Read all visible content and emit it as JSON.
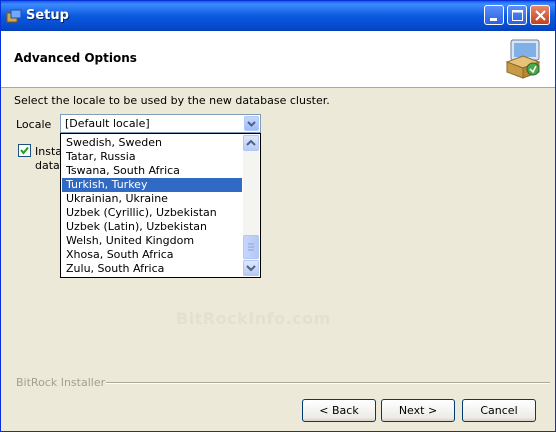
{
  "window": {
    "title": "Setup",
    "minimize_icon": "minimize-icon",
    "maximize_icon": "maximize-icon",
    "close_icon": "close-icon"
  },
  "header": {
    "title": "Advanced Options",
    "icon": "installer-box-icon"
  },
  "instruction": "Select the locale to be used by the new database cluster.",
  "locale": {
    "label": "Locale",
    "selected_value": "[Default locale]",
    "options_visible": [
      "Swedish, Sweden",
      "Tatar, Russia",
      "Tswana, South Africa",
      "Turkish, Turkey",
      "Ukrainian, Ukraine",
      "Uzbek (Cyrillic), Uzbekistan",
      "Uzbek (Latin), Uzbekistan",
      "Welsh, United Kingdom",
      "Xhosa, South Africa",
      "Zulu, South Africa"
    ],
    "highlighted": "Turkish, Turkey"
  },
  "checkbox": {
    "checked": true,
    "label_line1": "Insta",
    "label_line2": "datab"
  },
  "watermark": "BitRockInfo.com",
  "footer": {
    "brand": "BitRock Installer",
    "back_label": "< Back",
    "next_label": "Next >",
    "cancel_label": "Cancel"
  },
  "colors": {
    "title_bar": "#0a5ee9",
    "selection": "#316ac5",
    "dialog_bg": "#ece9d8"
  }
}
